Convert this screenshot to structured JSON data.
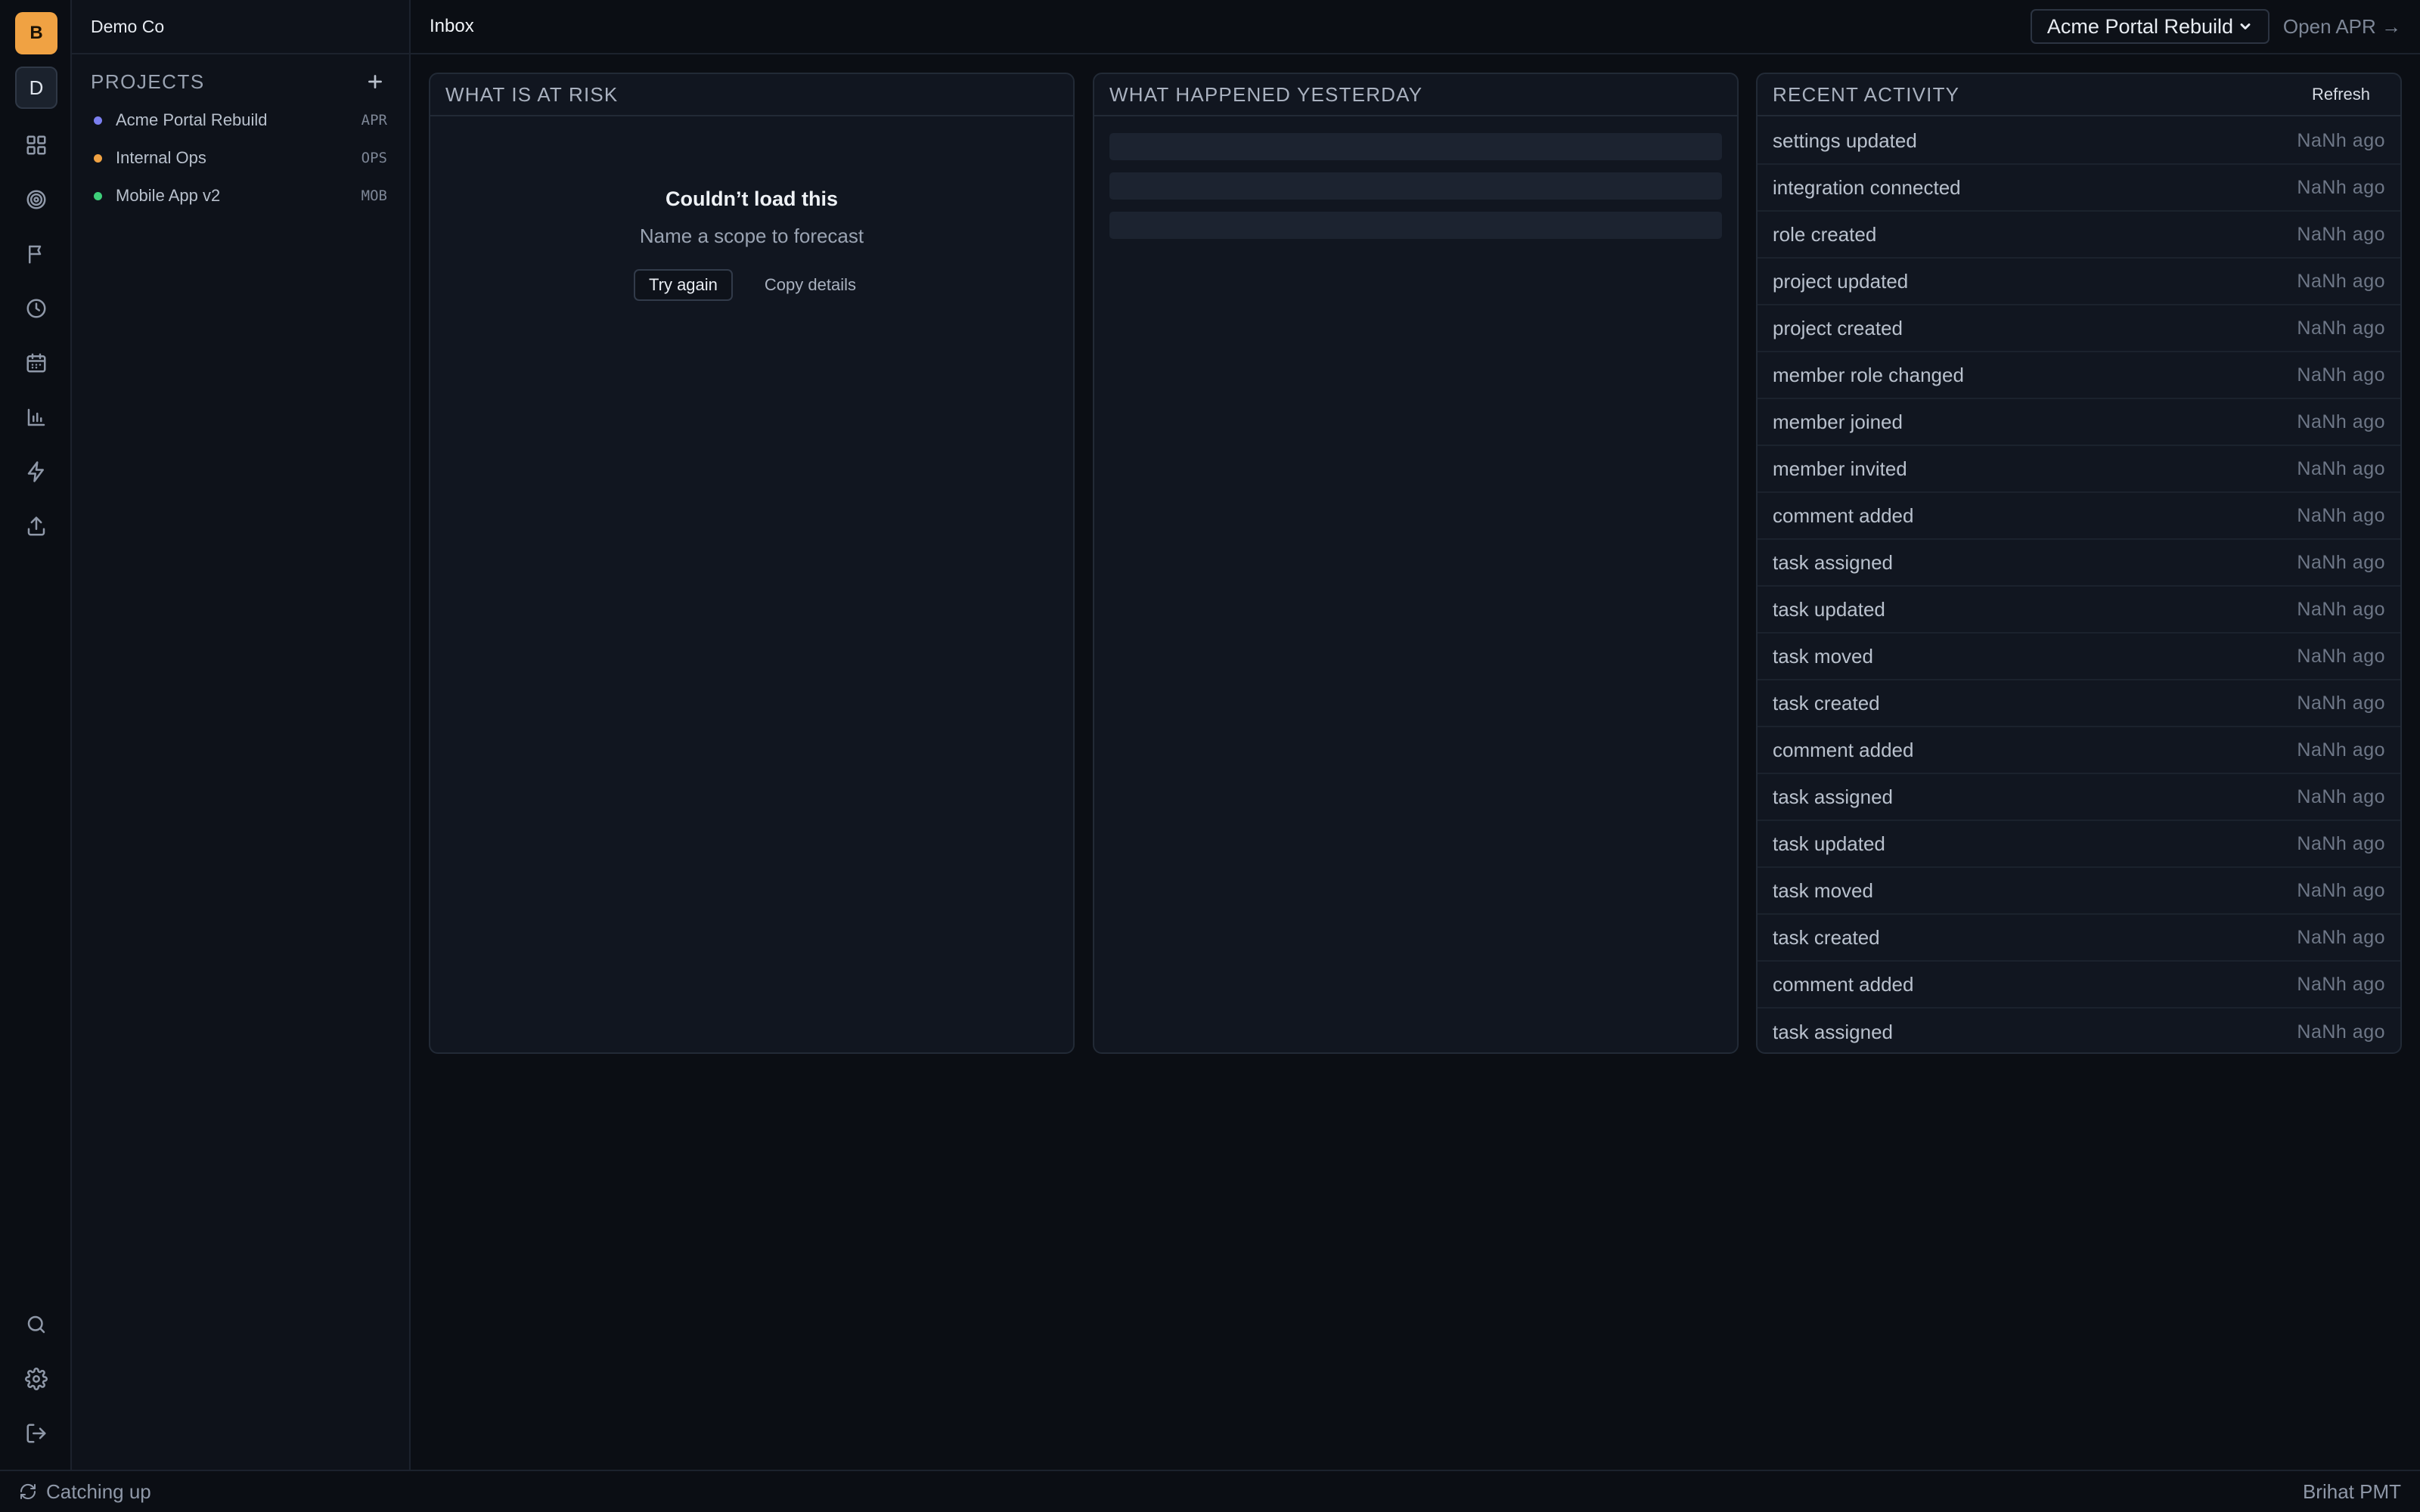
{
  "workspace": {
    "badge": "B",
    "switcher": "D",
    "name": "Demo Co"
  },
  "rail": {
    "icons": [
      "dashboard-icon",
      "target-icon",
      "flag-icon",
      "clock-icon",
      "calendar-icon",
      "bar-chart-icon",
      "zap-icon",
      "upload-icon"
    ],
    "bottom_icons": [
      "search-icon",
      "gear-icon",
      "logout-icon"
    ]
  },
  "sidebar": {
    "projects_title": "PROJECTS",
    "projects": [
      {
        "name": "Acme Portal Rebuild",
        "code": "APR",
        "color": "#7b7ff0"
      },
      {
        "name": "Internal Ops",
        "code": "OPS",
        "color": "#f0a243"
      },
      {
        "name": "Mobile App v2",
        "code": "MOB",
        "color": "#3ecf7a"
      }
    ]
  },
  "header": {
    "title": "Inbox",
    "project_select": "Acme Portal Rebuild",
    "open_link": "Open APR →"
  },
  "panels": {
    "risk": {
      "title": "WHAT IS AT RISK",
      "error_title": "Couldn’t load this",
      "error_message": "Name a scope to forecast",
      "retry_label": "Try again",
      "copy_label": "Copy details"
    },
    "yesterday": {
      "title": "WHAT HAPPENED YESTERDAY"
    },
    "activity": {
      "title": "RECENT ACTIVITY",
      "refresh_label": "Refresh",
      "items": [
        {
          "label": "settings updated",
          "time": "NaNh ago"
        },
        {
          "label": "integration connected",
          "time": "NaNh ago"
        },
        {
          "label": "role created",
          "time": "NaNh ago"
        },
        {
          "label": "project updated",
          "time": "NaNh ago"
        },
        {
          "label": "project created",
          "time": "NaNh ago"
        },
        {
          "label": "member role changed",
          "time": "NaNh ago"
        },
        {
          "label": "member joined",
          "time": "NaNh ago"
        },
        {
          "label": "member invited",
          "time": "NaNh ago"
        },
        {
          "label": "comment added",
          "time": "NaNh ago"
        },
        {
          "label": "task assigned",
          "time": "NaNh ago"
        },
        {
          "label": "task updated",
          "time": "NaNh ago"
        },
        {
          "label": "task moved",
          "time": "NaNh ago"
        },
        {
          "label": "task created",
          "time": "NaNh ago"
        },
        {
          "label": "comment added",
          "time": "NaNh ago"
        },
        {
          "label": "task assigned",
          "time": "NaNh ago"
        },
        {
          "label": "task updated",
          "time": "NaNh ago"
        },
        {
          "label": "task moved",
          "time": "NaNh ago"
        },
        {
          "label": "task created",
          "time": "NaNh ago"
        },
        {
          "label": "comment added",
          "time": "NaNh ago"
        },
        {
          "label": "task assigned",
          "time": "NaNh ago"
        }
      ]
    }
  },
  "status": {
    "sync_text": "Catching up",
    "timezone": "Brihat PMT"
  }
}
